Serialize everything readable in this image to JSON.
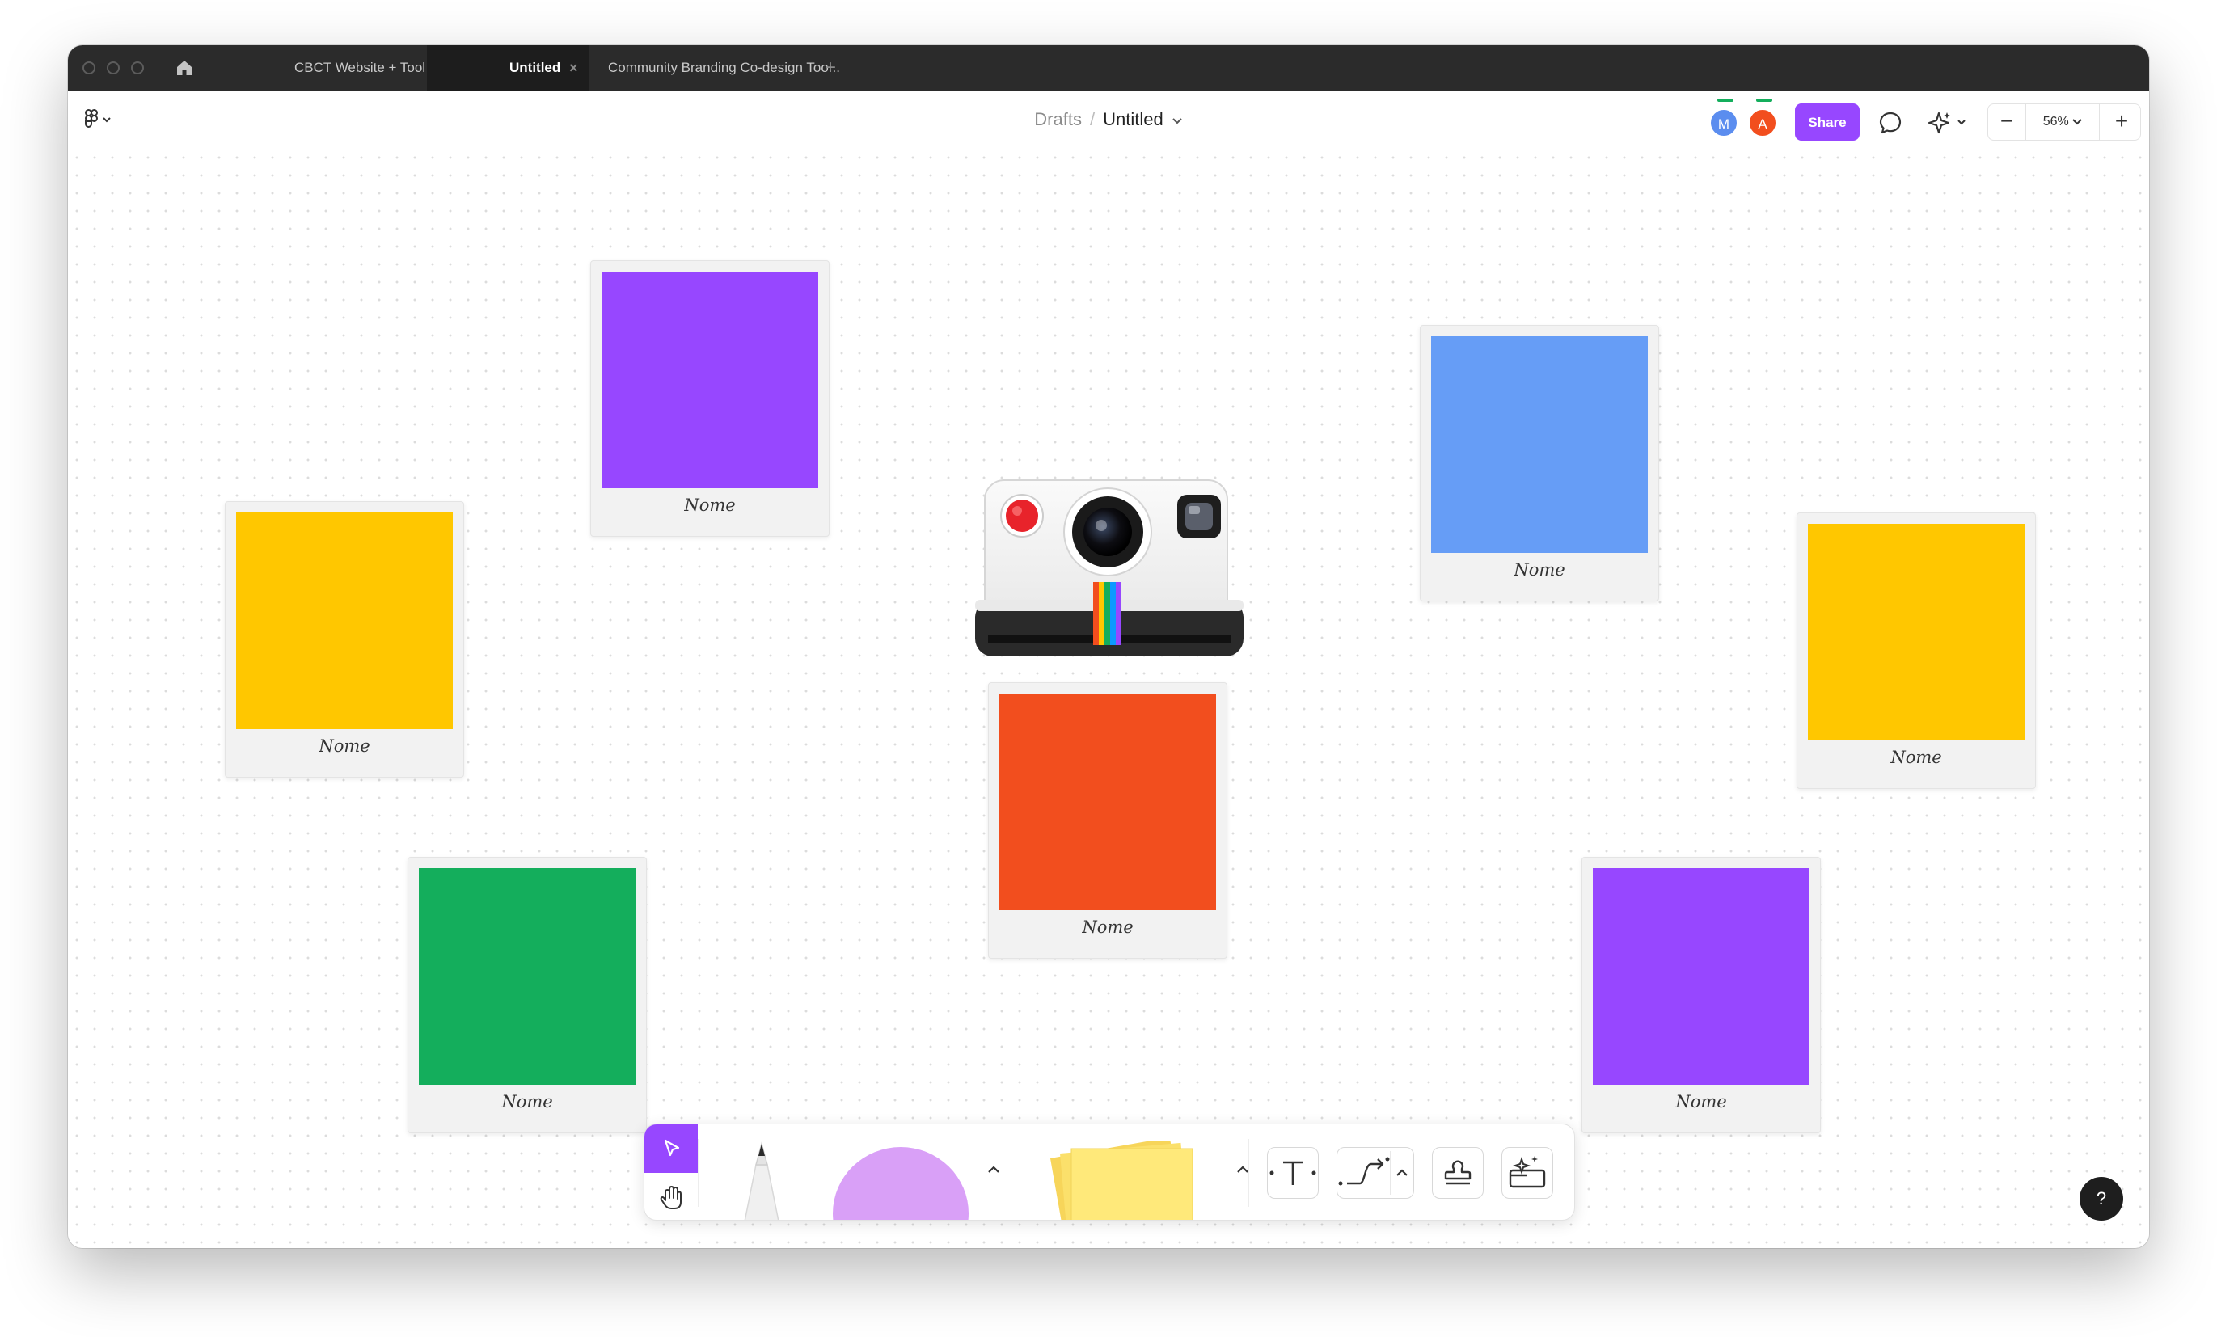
{
  "tabs": {
    "items": [
      {
        "label": "CBCT Website + Tool Beta"
      },
      {
        "label": "Untitled",
        "close": "×"
      },
      {
        "label": "Community Branding Co-design Too..."
      }
    ],
    "add": "+"
  },
  "header": {
    "breadcrumb_parent": "Drafts",
    "separator": "/",
    "title": "Untitled",
    "avatars": [
      {
        "initial": "M",
        "color": "#5b8def"
      },
      {
        "initial": "A",
        "color": "#f24e1e"
      }
    ],
    "share_label": "Share",
    "zoom_minus": "−",
    "zoom_value": "56%",
    "zoom_plus": "+"
  },
  "canvas": {
    "polaroids": [
      {
        "color": "#9747ff",
        "caption": "Nome"
      },
      {
        "color": "#ffc700",
        "caption": "Nome"
      },
      {
        "color": "#669df6",
        "caption": "Nome"
      },
      {
        "color": "#ffc700",
        "caption": "Nome"
      },
      {
        "color": "#f24e1e",
        "caption": "Nome"
      },
      {
        "color": "#14ae5c",
        "caption": "Nome"
      },
      {
        "color": "#9747ff",
        "caption": "Nome"
      }
    ]
  },
  "toolbar": {
    "accent": "#9747ff",
    "shape_color": "#d9a0f7",
    "sticky_color": "#ffe97a"
  },
  "help": {
    "label": "?"
  },
  "icons": [
    "home-icon",
    "figma-menu-icon",
    "chevron-down-icon",
    "comment-icon",
    "ai-sparkle-icon",
    "cursor-arrow-icon",
    "hand-icon",
    "pen-icon",
    "caret-up-icon",
    "text-icon",
    "connector-icon",
    "stamp-icon",
    "widgets-icon"
  ]
}
